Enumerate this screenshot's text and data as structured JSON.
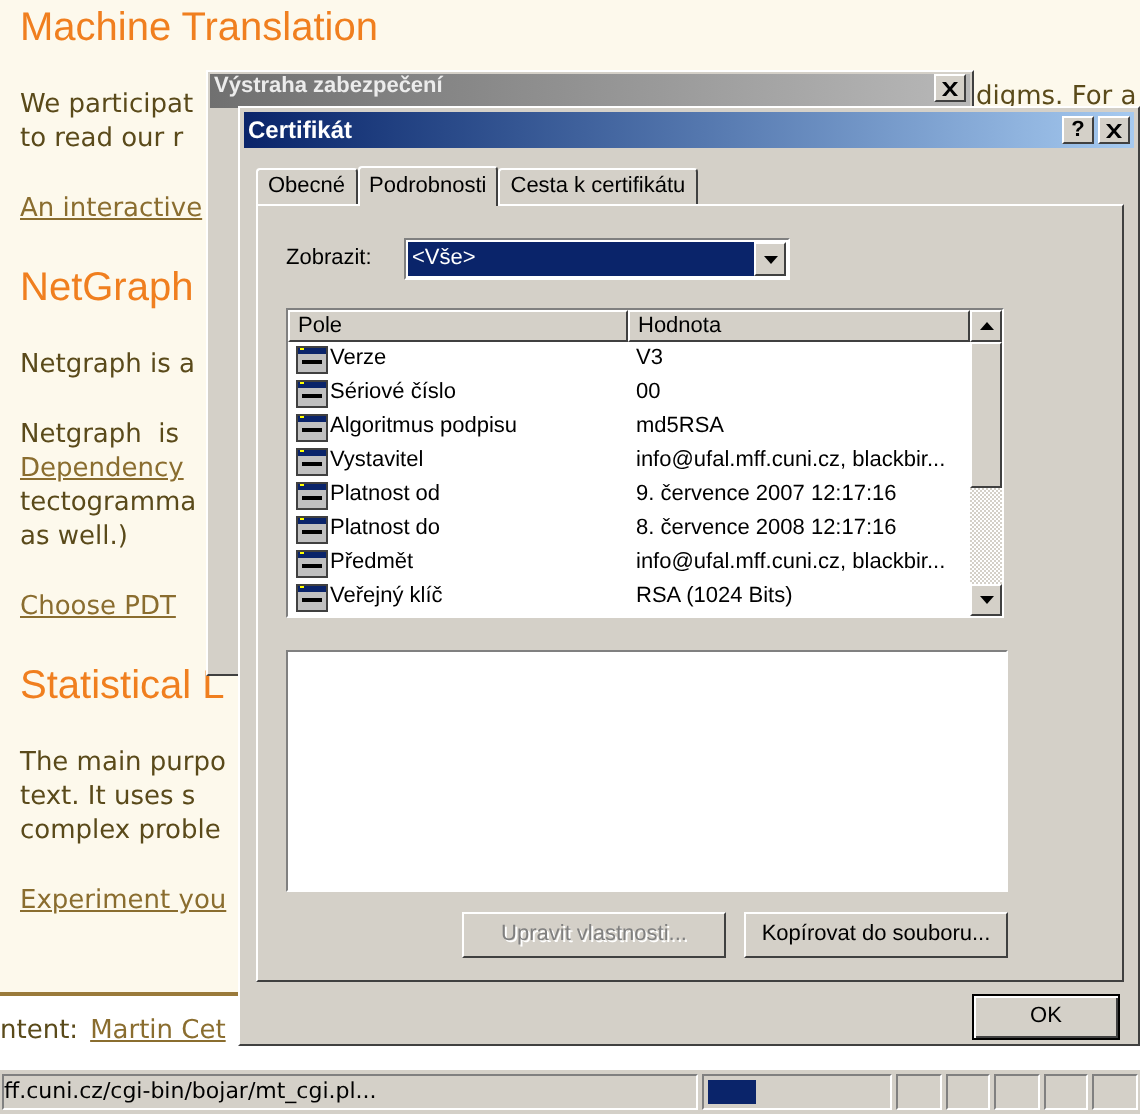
{
  "page": {
    "sections": [
      {
        "heading": "Machine Translation",
        "blocks": [
          [
            {
              "kind": "text",
              "text": "We participat"
            },
            {
              "kind": "text",
              "text": "to read our r"
            }
          ],
          [
            {
              "kind": "link",
              "text": "An interactive"
            }
          ]
        ]
      },
      {
        "heading": "NetGraph",
        "blocks": [
          [
            {
              "kind": "text",
              "text": "Netgraph is a"
            }
          ],
          [
            {
              "kind": "text",
              "text": "Netgraph  is"
            },
            {
              "kind": "link",
              "text": "Dependency"
            },
            {
              "kind": "text",
              "text": "tectogramma"
            },
            {
              "kind": "text",
              "text": "as well.)"
            }
          ],
          [
            {
              "kind": "link",
              "text": "Choose PDT"
            }
          ]
        ]
      },
      {
        "heading": "Statistical L",
        "blocks": [
          [
            {
              "kind": "text",
              "text": "The main purpo"
            },
            {
              "kind": "text",
              "text": "text. It uses s"
            },
            {
              "kind": "text",
              "text": "complex proble"
            }
          ],
          [
            {
              "kind": "link",
              "text": "Experiment you"
            }
          ]
        ]
      }
    ],
    "right_fragment": "digms. For a",
    "footer": {
      "text": "ntent:",
      "link": "Martin Cet"
    }
  },
  "status_bar": {
    "url": "ff.cuni.cz/cgi-bin/bojar/mt_cgi.pl...",
    "progress": {
      "level": 0.27
    }
  },
  "warning_dialog": {
    "title": "Výstraha zabezpečení",
    "active": false
  },
  "certificate_dialog": {
    "title": "Certifikát",
    "active": true,
    "help_button": "?",
    "tabs": [
      {
        "label": "Obecné",
        "selected": false
      },
      {
        "label": "Podrobnosti",
        "selected": true
      },
      {
        "label": "Cesta k certifikátu",
        "selected": false
      }
    ],
    "show_label": "Zobrazit:",
    "show_value": "<Vše>",
    "columns": [
      "Pole",
      "Hodnota"
    ],
    "rows": [
      {
        "field": "Verze",
        "value": "V3"
      },
      {
        "field": "Sériové číslo",
        "value": "00"
      },
      {
        "field": "Algoritmus podpisu",
        "value": "md5RSA"
      },
      {
        "field": "Vystavitel",
        "value": "info@ufal.mff.cuni.cz, blackbir..."
      },
      {
        "field": "Platnost od",
        "value": "9. července 2007 12:17:16"
      },
      {
        "field": "Platnost do",
        "value": "8. července 2008 12:17:16"
      },
      {
        "field": "Předmět",
        "value": "info@ufal.mff.cuni.cz, blackbir..."
      },
      {
        "field": "Veřejný klíč",
        "value": "RSA (1024 Bits)"
      }
    ],
    "buttons": [
      {
        "label": "Upravit vlastnosti...",
        "disabled": true
      },
      {
        "label": "Kopírovat do souboru...",
        "disabled": false
      }
    ],
    "ok": "OK"
  }
}
